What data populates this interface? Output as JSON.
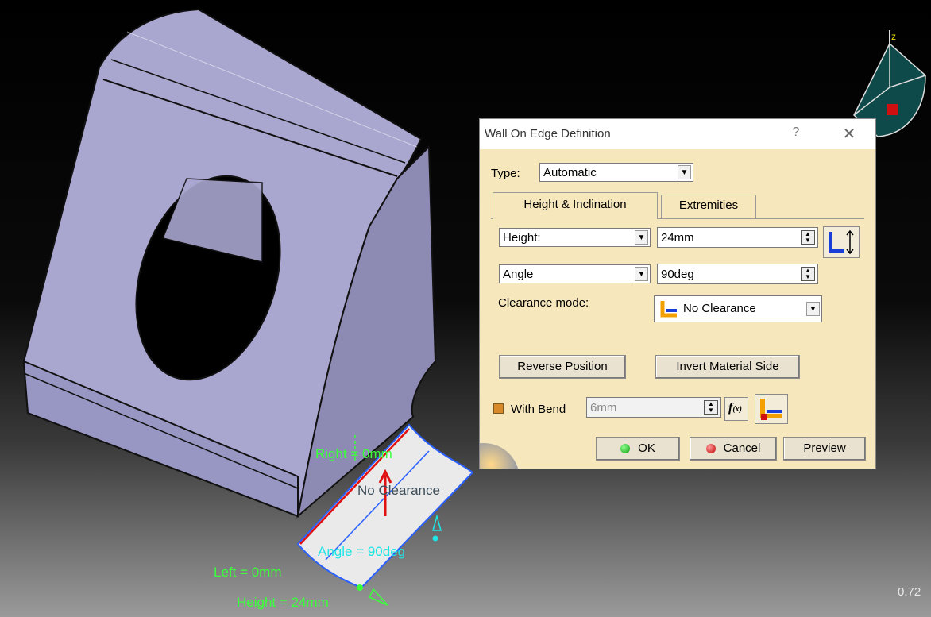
{
  "dialog": {
    "title": "Wall On Edge Definition",
    "help_label": "?",
    "close_label": "✕",
    "type_label": "Type:",
    "type_value": "Automatic",
    "tabs": [
      "Height & Inclination",
      "Extremities"
    ],
    "height_mode": "Height:",
    "height_value": "24mm",
    "angle_mode": "Angle",
    "angle_value": "90deg",
    "clearance_label": "Clearance mode:",
    "clearance_value": "No Clearance",
    "reverse_position": "Reverse Position",
    "invert_material_side": "Invert Material Side",
    "with_bend_label": "With Bend",
    "bend_radius": "6mm",
    "ok_label": "OK",
    "cancel_label": "Cancel",
    "preview_label": "Preview"
  },
  "viewport": {
    "annotations": {
      "right": "Right = 0mm",
      "no_clearance": "No Clearance",
      "angle": "Angle = 90deg",
      "left": "Left = 0mm",
      "height": "Height = 24mm"
    },
    "compass_axis_z": "z",
    "zoom_readout": "0,72"
  },
  "colors": {
    "part_face": "#a9a6cf",
    "dialog_bg": "#f6e7bd",
    "annotation_green": "#3bff3b",
    "annotation_cyan": "#1ee6e6"
  }
}
